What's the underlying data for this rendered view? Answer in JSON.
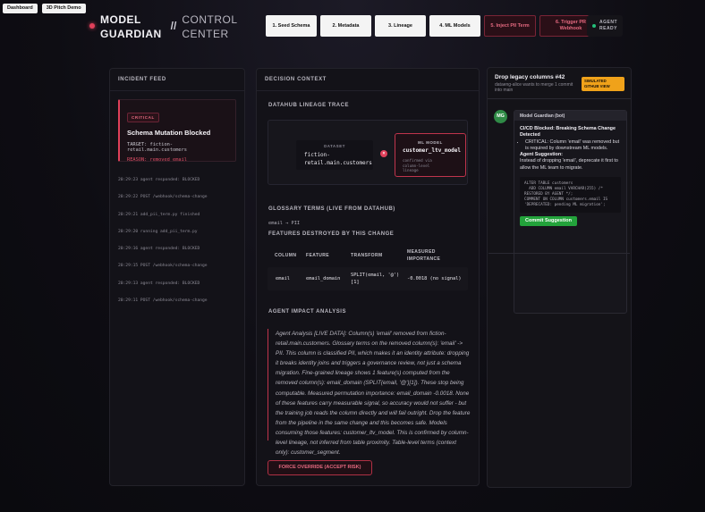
{
  "topnav": {
    "dashboard": "Dashboard",
    "pitch": "3D Pitch Demo"
  },
  "header": {
    "title_line1": "MODEL",
    "title_line2": "GUARDIAN",
    "separator": "//",
    "subtitle_line1": "CONTROL",
    "subtitle_line2": "CENTER"
  },
  "steps": [
    {
      "label": "1. Seed Schema"
    },
    {
      "label": "2. Metadata"
    },
    {
      "label": "3. Lineage"
    },
    {
      "label": "4. ML Models"
    },
    {
      "label": "5. Inject PII Term"
    },
    {
      "label": "6. Trigger PR Webhook"
    }
  ],
  "agent_status": {
    "line1": "AGENT",
    "line2": "READY",
    "color": "#23c07a"
  },
  "feed": {
    "title": "INCIDENT FEED",
    "incident": {
      "badge": "CRITICAL",
      "title": "Schema Mutation Blocked",
      "target": "TARGET: fiction-retail.main.customers",
      "reason": "REASON: removed email"
    },
    "logs": [
      "20:29:23 agent responded: BLOCKED",
      "20:29:22 POST /webhook/schema-change",
      "20:29:21 add_pii_term.py finished",
      "20:29:20 running add_pii_term.py",
      "20:29:16 agent responded: BLOCKED",
      "20:29:15 POST /webhook/schema-change",
      "20:29:13 agent responded: BLOCKED",
      "20:29:11 POST /webhook/schema-change"
    ]
  },
  "decision": {
    "title": "DECISION CONTEXT",
    "lineage_title": "DATAHUB LINEAGE TRACE",
    "dataset_label": "DATASET",
    "dataset_value_1": "fiction-",
    "dataset_value_2": "retail.main.customers",
    "ml_label": "ML MODEL",
    "ml_value": "customer_ltv_model",
    "ml_note": "confirmed via column-level lineage",
    "glossary_title": "GLOSSARY TERMS (LIVE FROM DATAHUB)",
    "glossary_value": "email → PII",
    "features_title": "FEATURES DESTROYED BY THIS CHANGE",
    "columns": [
      "COLUMN",
      "FEATURE",
      "TRANSFORM",
      "MEASURED",
      "IMPORTANCE"
    ],
    "row": {
      "column": "email",
      "feature": "email_domain",
      "transform_1": "SPLIT(email, '@')",
      "transform_2": "[1]",
      "importance": "-0.0018 (no signal)"
    },
    "impact_title": "AGENT IMPACT ANALYSIS",
    "analysis": "Agent Analysis [LIVE DATA]: Column(s) 'email' removed from fiction-retail.main.customers. Glossary terms on the removed column(s): 'email' -> PII. This column is classified PII, which makes it an identity attribute: dropping it breaks identity joins and triggers a governance review, not just a schema migration. Fine-grained lineage shows 1 feature(s) computed from the removed column(s): email_domain (SPLIT(email, '@')[1]). These stop being computable. Measured permutation importance: email_domain -0.0018. None of these features carry measurable signal, so accuracy would not suffer - but the training job reads the column directly and will fail outright. Drop the feature from the pipeline in the same change and this becomes safe. Models consuming those features: customer_ltv_model. This is confirmed by column-level lineage, not inferred from table proximity. Table-level terms (context only): customer_segment.",
    "override_label": "FORCE OVERRIDE (ACCEPT RISK)"
  },
  "pr": {
    "title": "Drop legacy columns #42",
    "subtitle": "dataeng-alice wants to merge 1 commit into main",
    "badge": "SIMULATED GITHUB VIEW",
    "avatar": "MG",
    "author": "Model Guardian (bot)",
    "heading": "CI/CD Blocked: Breaking Schema Change Detected",
    "bullet": "CRITICAL: Column 'email' was removed but is required by downstream ML models.",
    "suggestion_label": "Agent Suggestion:",
    "suggestion": "Instead of dropping 'email', deprecate it first to allow the ML team to migrate.",
    "code": "ALTER TABLE customers\n  ADD COLUMN email VARCHAR(255) /*\nRESTORED BY AGENT */;\nCOMMENT ON COLUMN customers.email IS\n'DEPRECATED: pending ML migration';",
    "commit_label": "Commit Suggestion"
  }
}
